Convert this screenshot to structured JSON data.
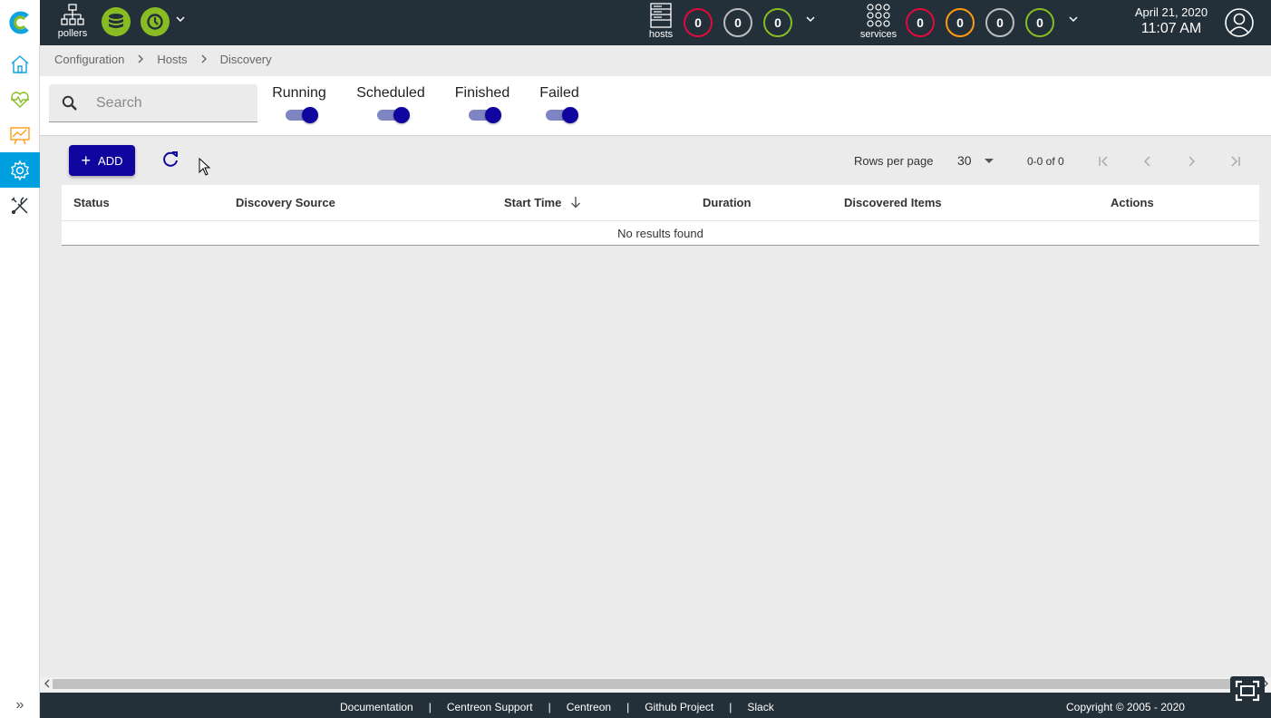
{
  "header": {
    "pollers_label": "pollers",
    "hosts_label": "hosts",
    "services_label": "services",
    "hosts_counts": [
      "0",
      "0",
      "0"
    ],
    "services_counts": [
      "0",
      "0",
      "0",
      "0"
    ],
    "date": "April 21, 2020",
    "time": "11:07 AM",
    "colors": {
      "critical": "#e00b3d",
      "unknown": "#bcbdc0",
      "ok": "#87bd23",
      "warning": "#ff9a13",
      "header_bg": "#232f39",
      "accent": "#10069f",
      "sidebar_active": "#009fdf"
    }
  },
  "sidebar": {
    "items": [
      {
        "name": "home-icon",
        "active": false
      },
      {
        "name": "monitoring-icon",
        "active": false
      },
      {
        "name": "reporting-icon",
        "active": false
      },
      {
        "name": "configuration-icon",
        "active": true
      },
      {
        "name": "administration-icon",
        "active": false
      }
    ],
    "expand_icon": "»"
  },
  "breadcrumb": {
    "items": [
      "Configuration",
      "Hosts",
      "Discovery"
    ],
    "separator": ">"
  },
  "search": {
    "placeholder": "Search",
    "value": ""
  },
  "filters": [
    {
      "label": "Running",
      "on": true
    },
    {
      "label": "Scheduled",
      "on": true
    },
    {
      "label": "Finished",
      "on": true
    },
    {
      "label": "Failed",
      "on": true
    }
  ],
  "toolbar": {
    "add_label": "ADD",
    "rows_per_page_label": "Rows per page",
    "rows_per_page_value": "30",
    "range": "0-0 of 0"
  },
  "table": {
    "columns": [
      "Status",
      "Discovery Source",
      "Start Time",
      "Duration",
      "Discovered Items",
      "Actions"
    ],
    "empty_message": "No results found"
  },
  "footer": {
    "links": [
      "Documentation",
      "Centreon Support",
      "Centreon",
      "Github Project",
      "Slack"
    ],
    "separator": "|",
    "copyright": "Copyright © 2005 - 2020"
  }
}
